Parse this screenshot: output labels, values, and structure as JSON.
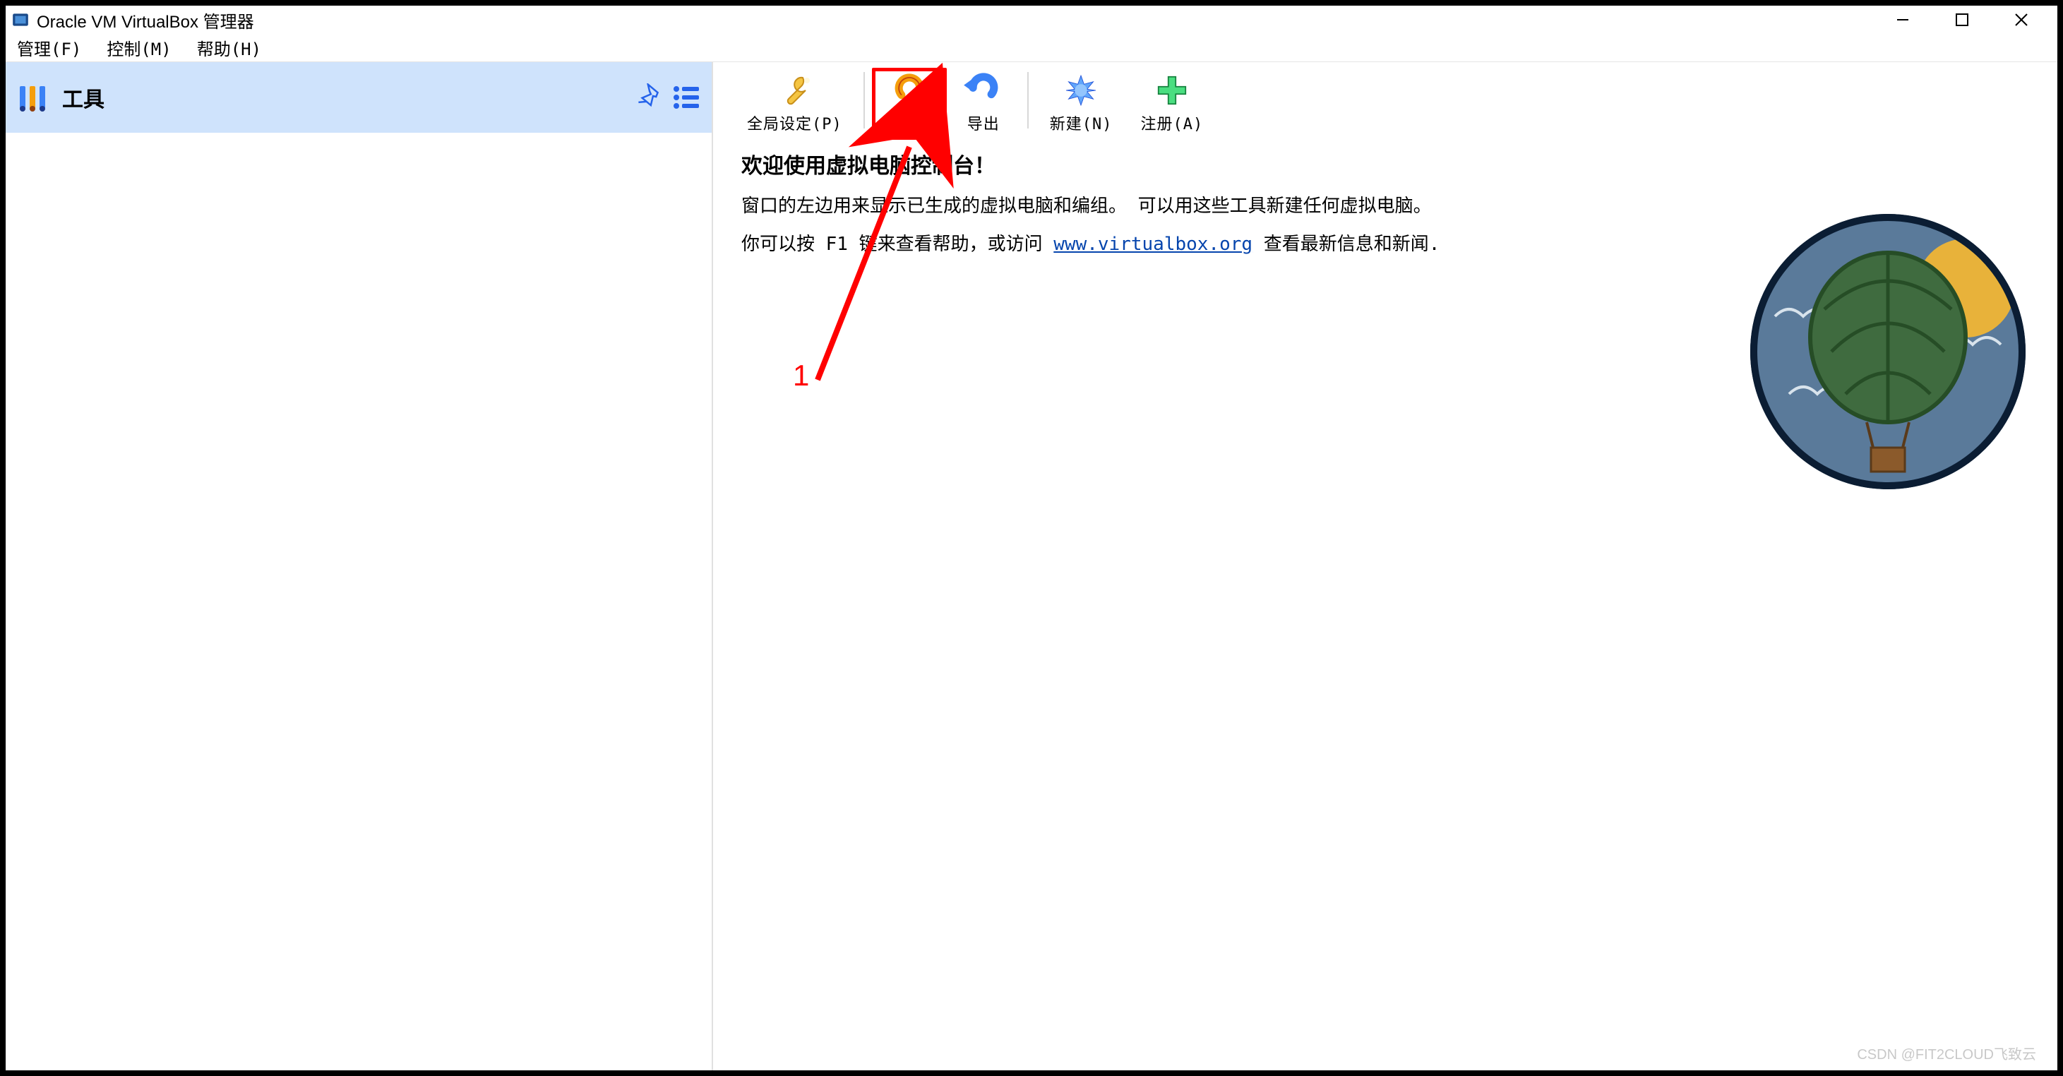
{
  "window": {
    "title": "Oracle VM VirtualBox 管理器"
  },
  "menu": {
    "manage": "管理(F)",
    "control": "控制(M)",
    "help": "帮助(H)"
  },
  "sidebar": {
    "tools_label": "工具"
  },
  "toolbar": {
    "global_settings": "全局设定(P)",
    "import": "导入",
    "export": "导出",
    "new": "新建(N)",
    "register": "注册(A)"
  },
  "welcome": {
    "heading": "欢迎使用虚拟电脑控制台！",
    "para1": "窗口的左边用来显示已生成的虚拟电脑和编组。 可以用这些工具新建任何虚拟电脑。",
    "para2a": "你可以按 F1 键来查看帮助，或访问 ",
    "link": "www.virtualbox.org",
    "para2b": " 查看最新信息和新闻."
  },
  "annotation": {
    "number": "1"
  },
  "watermark": "CSDN @FIT2CLOUD飞致云"
}
